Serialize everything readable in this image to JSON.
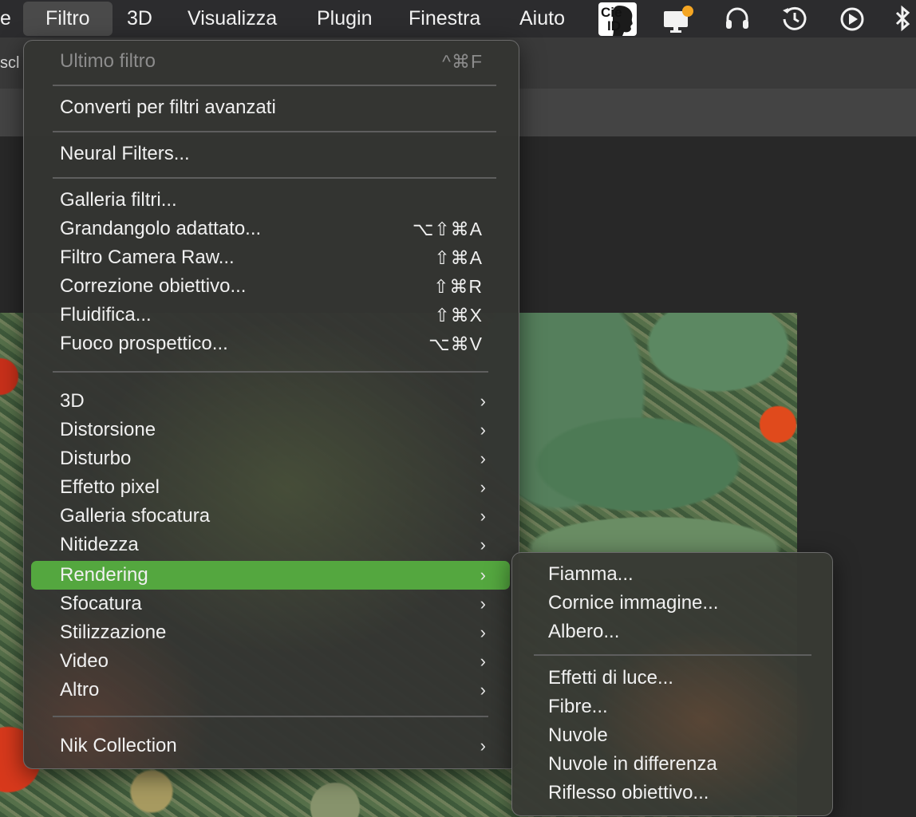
{
  "menubar": {
    "items": [
      {
        "label": "e",
        "active": false
      },
      {
        "label": "Filtro",
        "active": true
      },
      {
        "label": "3D",
        "active": false
      },
      {
        "label": "Visualizza",
        "active": false
      },
      {
        "label": "Plugin",
        "active": false
      },
      {
        "label": "Finestra",
        "active": false
      },
      {
        "label": "Aiuto",
        "active": false
      }
    ],
    "status_icons": [
      "cie-id-icon",
      "display-notification-icon",
      "headphones-icon",
      "time-machine-icon",
      "play-icon",
      "bluetooth-icon"
    ],
    "cie_text": [
      "Cie",
      "ID"
    ]
  },
  "toolbar": {
    "partial_text": "scl"
  },
  "filter_menu": {
    "items": [
      {
        "label": "Ultimo filtro",
        "shortcut": "^⌘F",
        "disabled": true
      },
      {
        "label": "Converti per filtri avanzati"
      },
      {
        "label": "Neural Filters..."
      },
      {
        "label": "Galleria filtri..."
      },
      {
        "label": "Grandangolo adattato...",
        "shortcut": "⌥⇧⌘A"
      },
      {
        "label": "Filtro Camera Raw...",
        "shortcut": "⇧⌘A"
      },
      {
        "label": "Correzione obiettivo...",
        "shortcut": "⇧⌘R"
      },
      {
        "label": "Fluidifica...",
        "shortcut": "⇧⌘X"
      },
      {
        "label": "Fuoco prospettico...",
        "shortcut": "⌥⌘V"
      },
      {
        "label": "3D",
        "submenu": true
      },
      {
        "label": "Distorsione",
        "submenu": true
      },
      {
        "label": "Disturbo",
        "submenu": true
      },
      {
        "label": "Effetto pixel",
        "submenu": true
      },
      {
        "label": "Galleria sfocatura",
        "submenu": true
      },
      {
        "label": "Nitidezza",
        "submenu": true
      },
      {
        "label": "Rendering",
        "submenu": true,
        "highlighted": true
      },
      {
        "label": "Sfocatura",
        "submenu": true
      },
      {
        "label": "Stilizzazione",
        "submenu": true
      },
      {
        "label": "Video",
        "submenu": true
      },
      {
        "label": "Altro",
        "submenu": true
      },
      {
        "label": "Nik Collection",
        "submenu": true
      }
    ],
    "chevron": "›",
    "highlight_color": "#54a73f"
  },
  "rendering_submenu": {
    "items": [
      {
        "label": "Fiamma..."
      },
      {
        "label": "Cornice immagine..."
      },
      {
        "label": "Albero..."
      },
      {
        "label": "Effetti di luce..."
      },
      {
        "label": "Fibre..."
      },
      {
        "label": "Nuvole"
      },
      {
        "label": "Nuvole in differenza"
      },
      {
        "label": "Riflesso obiettivo..."
      }
    ]
  }
}
